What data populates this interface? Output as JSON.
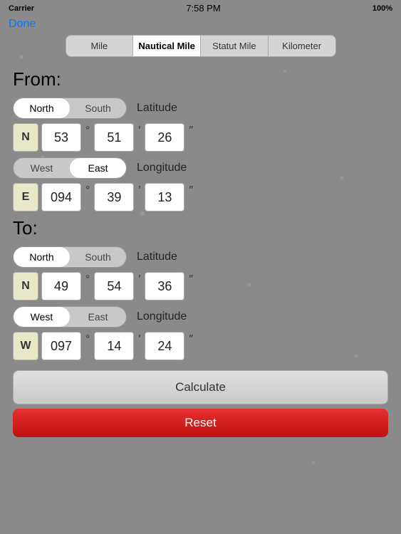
{
  "statusBar": {
    "carrier": "Carrier",
    "time": "7:58 PM",
    "battery": "100%"
  },
  "doneButton": "Done",
  "unitTabs": [
    {
      "label": "Mile",
      "active": false
    },
    {
      "label": "Nautical Mile",
      "active": true
    },
    {
      "label": "Statut Mile",
      "active": false
    },
    {
      "label": "Kilometer",
      "active": false
    }
  ],
  "fromLabel": "From:",
  "toLabel": "To:",
  "fromLatitude": {
    "dirLabel": "Latitude",
    "dir1": "North",
    "dir2": "South",
    "activeDir": "North",
    "indicator": "N",
    "degrees": "53",
    "minutes": "51",
    "seconds": "26"
  },
  "fromLongitude": {
    "dirLabel": "Longitude",
    "dir1": "West",
    "dir2": "East",
    "activeDir": "East",
    "indicator": "E",
    "degrees": "094",
    "minutes": "39",
    "seconds": "13"
  },
  "toLatitude": {
    "dirLabel": "Latitude",
    "dir1": "North",
    "dir2": "South",
    "activeDir": "North",
    "indicator": "N",
    "degrees": "49",
    "minutes": "54",
    "seconds": "36"
  },
  "toLongitude": {
    "dirLabel": "Longitude",
    "dir1": "West",
    "dir2": "East",
    "activeDir": "West",
    "indicator": "W",
    "degrees": "097",
    "minutes": "14",
    "seconds": "24"
  },
  "calculateLabel": "Calculate",
  "resetLabel": "Reset"
}
